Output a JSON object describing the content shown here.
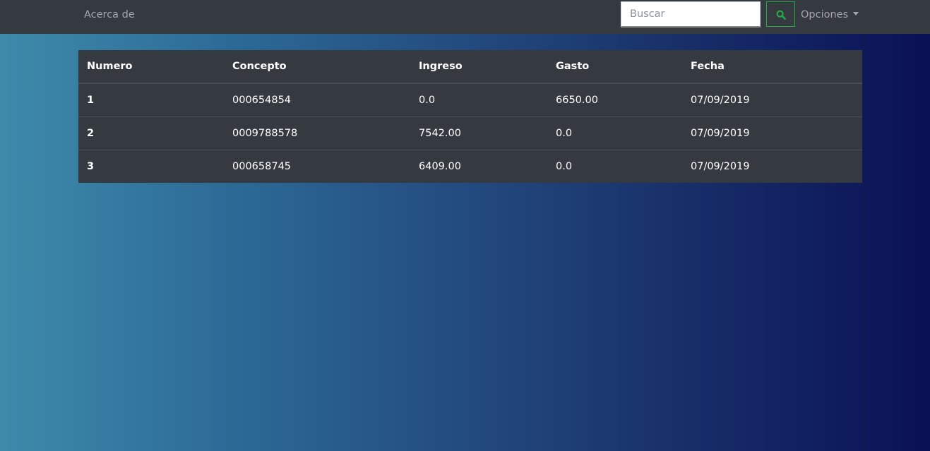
{
  "navbar": {
    "about_label": "Acerca de",
    "search_placeholder": "Buscar",
    "search_value": "",
    "options_label": "Opciones"
  },
  "table": {
    "headers": {
      "numero": "Numero",
      "concepto": "Concepto",
      "ingreso": "Ingreso",
      "gasto": "Gasto",
      "fecha": "Fecha"
    },
    "rows": [
      {
        "numero": "1",
        "concepto": "000654854",
        "ingreso": "0.0",
        "gasto": "6650.00",
        "fecha": "07/09/2019"
      },
      {
        "numero": "2",
        "concepto": "0009788578",
        "ingreso": "7542.00",
        "gasto": "0.0",
        "fecha": "07/09/2019"
      },
      {
        "numero": "3",
        "concepto": "000658745",
        "ingreso": "6409.00",
        "gasto": "0.0",
        "fecha": "07/09/2019"
      }
    ]
  },
  "colors": {
    "navbar_bg": "#343a40",
    "table_bg": "#343a40",
    "accent_success": "#28a745",
    "bg_gradient_start": "#3e8aab",
    "bg_gradient_end": "#0a1155"
  },
  "icons": {
    "search": "search-icon",
    "caret": "caret-down-icon"
  }
}
